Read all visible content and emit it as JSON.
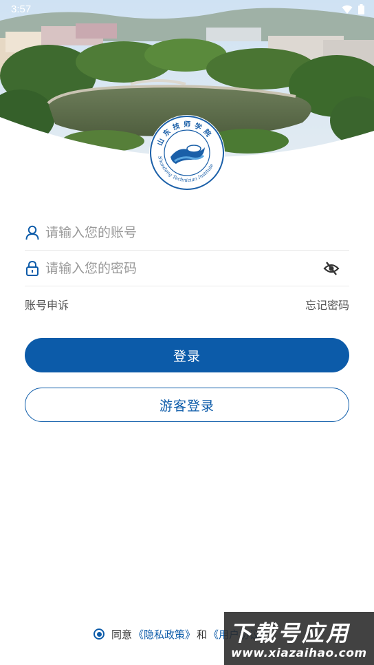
{
  "status_bar": {
    "time": "3:57",
    "icons": [
      "wifi-icon",
      "battery-icon"
    ]
  },
  "school": {
    "emblem_chinese": "山东技师学院",
    "emblem_english": "Shandong Technician Institute"
  },
  "login_form": {
    "account_placeholder": "请输入您的账号",
    "password_placeholder": "请输入您的密码",
    "account_appeal": "账号申诉",
    "forgot_password": "忘记密码",
    "login_button": "登录",
    "guest_login_button": "游客登录"
  },
  "agreement": {
    "agree_text": "同意",
    "privacy_policy": "《隐私政策》",
    "and_text": "和",
    "user_agreement": "《用户协议》"
  },
  "watermark": {
    "title": "下载号应用",
    "url": "www.xiazaihao.com"
  },
  "colors": {
    "primary": "#0c5ba9",
    "divider": "#e9e9e9",
    "placeholder": "#9a9a9a"
  }
}
